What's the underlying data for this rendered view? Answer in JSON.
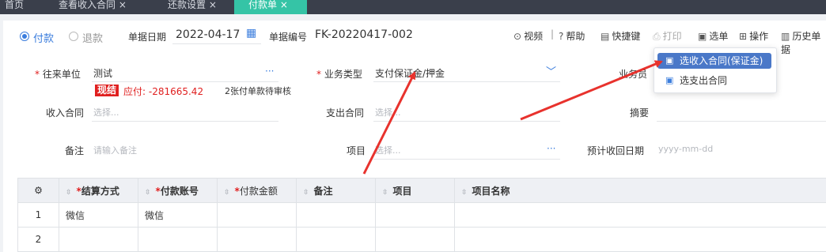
{
  "tabs": [
    {
      "label": "首页",
      "active": false
    },
    {
      "label": "查看收入合同 ×",
      "active": false
    },
    {
      "label": "还款设置 ×",
      "active": false
    },
    {
      "label": "付款单 ×",
      "active": true
    }
  ],
  "radios": [
    {
      "label": "付款",
      "checked": true
    },
    {
      "label": "退款",
      "checked": false
    }
  ],
  "header": {
    "date_label": "单据日期",
    "date_value": "2022-04-17",
    "no_label": "单据编号",
    "no_value": "FK-20220417-002"
  },
  "toolbar": {
    "video": "视频",
    "help": "帮助",
    "shortcut": "快捷键",
    "print": "打印",
    "select": "选单",
    "operate": "操作",
    "history": "历史单据"
  },
  "dropdown": {
    "items": [
      "选收入合同(保证金)",
      "选支出合同"
    ]
  },
  "form": {
    "partner_label": "往来单位",
    "partner_value": "测试",
    "settled_badge": "现结",
    "payable_text": "应付: -281665.42",
    "pending_text": "2张付单款待审核",
    "biz_type_label": "业务类型",
    "biz_type_value": "支付保证金/押金",
    "biz_label_partial": "业务员",
    "income_contract_label": "收入合同",
    "income_contract_ph": "选择...",
    "expense_contract_label": "支出合同",
    "expense_contract_ph": "选择...",
    "summary_label": "摘要",
    "remark_label": "备注",
    "remark_ph": "请输入备注",
    "project_label": "项目",
    "project_ph": "选择...",
    "expected_date_label": "预计收回日期",
    "expected_date_ph": "yyyy-mm-dd",
    "ellipsis": "···"
  },
  "table": {
    "headers": [
      {
        "label": "结算方式",
        "required": true
      },
      {
        "label": "付款账号",
        "required": true
      },
      {
        "label": "付款金额",
        "required": true
      },
      {
        "label": "备注",
        "required": false
      },
      {
        "label": "项目",
        "required": false
      },
      {
        "label": "项目名称",
        "required": false
      }
    ],
    "rows": [
      {
        "index": "1",
        "cells": [
          "微信",
          "微信",
          "",
          "",
          "",
          ""
        ]
      },
      {
        "index": "2",
        "cells": [
          "",
          "",
          "",
          "",
          "",
          ""
        ]
      }
    ]
  },
  "colors": {
    "accent": "#3b7ddd",
    "tab_active": "#35c4a6",
    "required": "#e02020",
    "badge": "#e02020",
    "arrow": "#e8322d"
  }
}
